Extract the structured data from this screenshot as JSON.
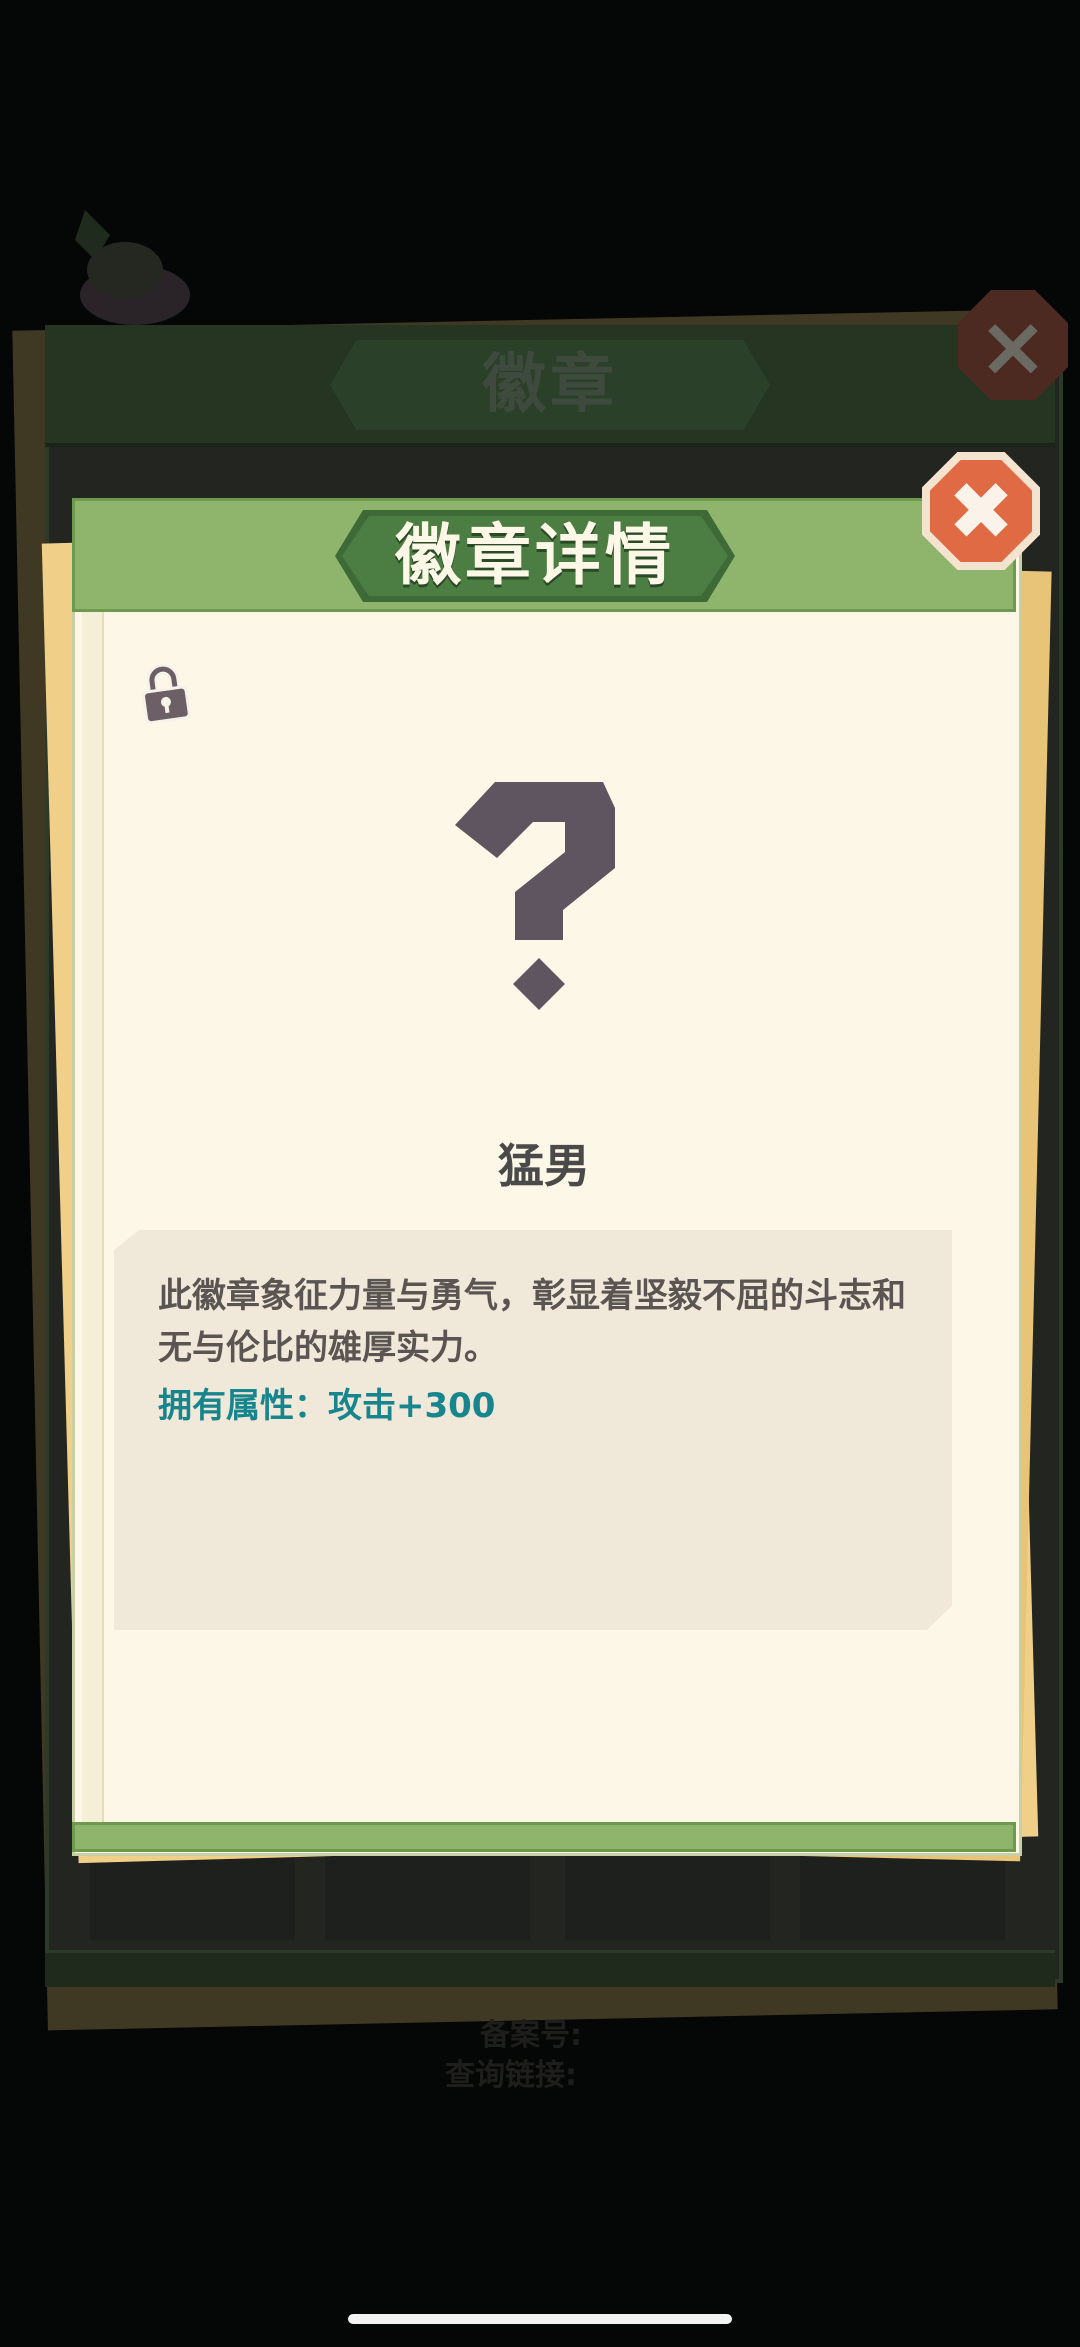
{
  "background_panel": {
    "title": "徽章",
    "footer_text_1": "备案号:",
    "footer_text_2": "查询链接:"
  },
  "modal": {
    "title": "徽章详情",
    "badge_name": "猛男",
    "description": "此徽章象征力量与勇气，彰显着坚毅不屈的斗志和无与伦比的雄厚实力。",
    "attribute": "拥有属性：攻击+300",
    "close_symbol": "✖",
    "locked": true
  },
  "colors": {
    "header_green": "#8fb56d",
    "title_banner": "#4c7d42",
    "close_orange": "#e06a43",
    "paper": "#fdf7e7",
    "attribute_teal": "#17858d",
    "question_mark": "#5e5560"
  },
  "icons": [
    "lock-icon",
    "question-mark-icon",
    "close-icon"
  ]
}
